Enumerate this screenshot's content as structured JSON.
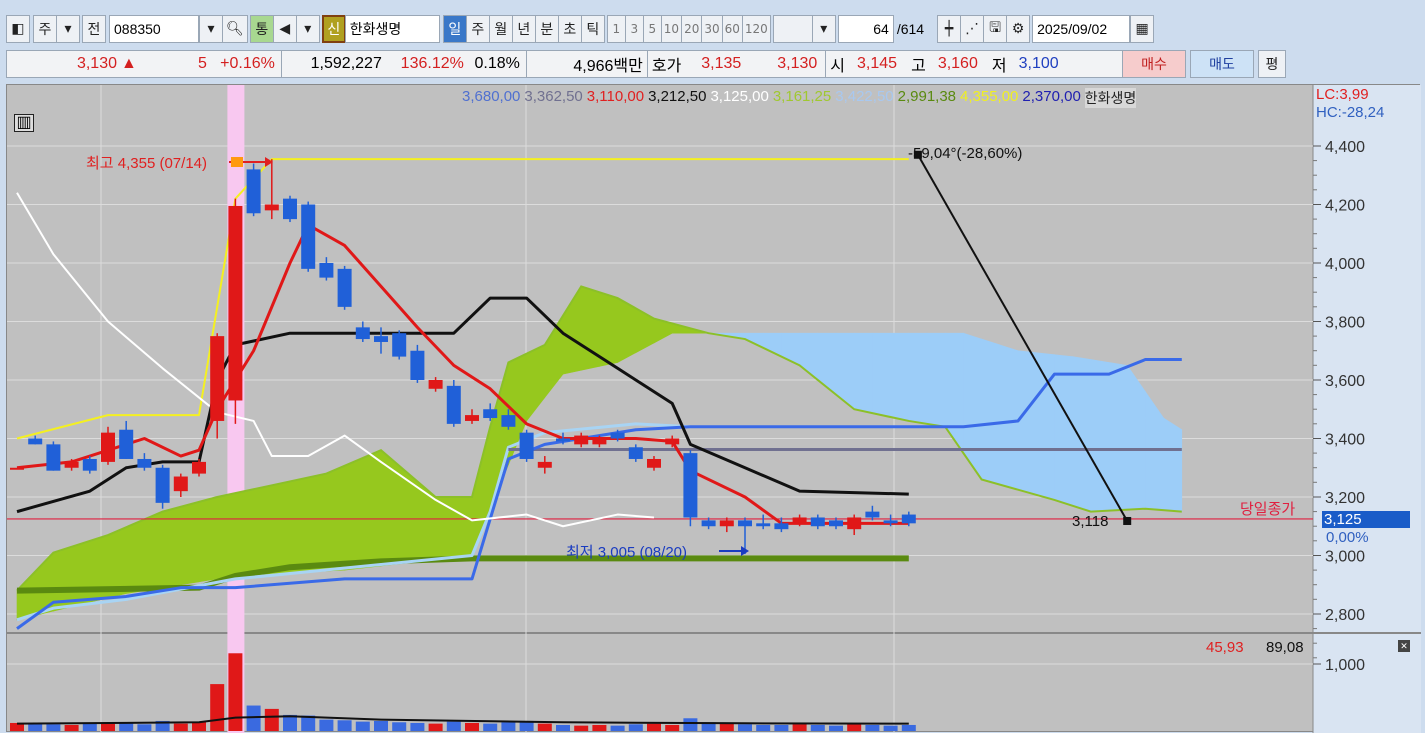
{
  "toolbar": {
    "market": "주",
    "prev": "전",
    "code": "088350",
    "tong": "통",
    "sin": "신",
    "stock_name": "한화생명",
    "periods": [
      "일",
      "주",
      "월",
      "년",
      "분",
      "초",
      "틱"
    ],
    "intervals": [
      "1",
      "3",
      "5",
      "10",
      "20",
      "30",
      "60",
      "120"
    ],
    "count": "64",
    "total": "/614",
    "date": "2025/09/02"
  },
  "info": {
    "price": "3,130",
    "arrow": "▲",
    "change": "5",
    "change_pct": "+0.16%",
    "volume": "1,592,227",
    "vol_ratio": "136.12%",
    "turnover": "0.18%",
    "amount": "4,966백만",
    "hoga_label": "호가",
    "ask": "3,135",
    "bid": "3,130",
    "open_label": "시",
    "open": "3,145",
    "high_label": "고",
    "high": "3,160",
    "low_label": "저",
    "low": "3,100",
    "buy": "매수",
    "sell": "매도",
    "avg": "평"
  },
  "legend": [
    {
      "t": "3,680,00",
      "c": "#5070d0"
    },
    {
      "t": "3,362,50",
      "c": "#707090"
    },
    {
      "t": "3,110,00",
      "c": "#e02020"
    },
    {
      "t": "3,212,50",
      "c": "#111111"
    },
    {
      "t": "3,125,00",
      "c": "#ffffff"
    },
    {
      "t": "3,161,25",
      "c": "#a0c830"
    },
    {
      "t": "3,422,50",
      "c": "#a8c8f0"
    },
    {
      "t": "2,991,38",
      "c": "#5a8a10"
    },
    {
      "t": "4,355,00",
      "c": "#f0f020"
    },
    {
      "t": "2,370,00",
      "c": "#2020b0"
    },
    {
      "t": "한화생명",
      "c": "#222222"
    }
  ],
  "lc": "LC:3,99",
  "hc": "HC:-28,24",
  "annotations": {
    "high": "최고 4,355 (07/14)",
    "low": "최저 3,005 (08/20)",
    "trend": "-59,04°(-28,60%)",
    "trend_end": "3,118",
    "close_label": "당일종가",
    "current_price": "3,125",
    "current_pct": "0,00%",
    "vol_legend1": "45,93",
    "vol_legend2": "89,08"
  },
  "colors": {
    "up": "#e01818",
    "down": "#2060d8"
  },
  "chart_data": {
    "type": "candlestick",
    "price_axis": {
      "ticks": [
        "4,400",
        "4,200",
        "4,000",
        "3,800",
        "3,600",
        "3,400",
        "3,200",
        "3,000",
        "2,800"
      ],
      "range": [
        2800,
        4400
      ]
    },
    "volume_axis": {
      "ticks": [
        "1,000"
      ]
    },
    "candles": [
      [
        3300,
        3420,
        3420,
        3300
      ],
      [
        3400,
        3410,
        3380,
        3380
      ],
      [
        3380,
        3390,
        3290,
        3290
      ],
      [
        3300,
        3330,
        3290,
        3320
      ],
      [
        3330,
        3340,
        3280,
        3290
      ],
      [
        3320,
        3440,
        3310,
        3420
      ],
      [
        3430,
        3460,
        3330,
        3330
      ],
      [
        3330,
        3350,
        3290,
        3300
      ],
      [
        3300,
        3310,
        3160,
        3180
      ],
      [
        3220,
        3280,
        3200,
        3270
      ],
      [
        3280,
        3330,
        3270,
        3320
      ],
      [
        3460,
        3760,
        3400,
        3750
      ],
      [
        3530,
        4220,
        3450,
        4195
      ],
      [
        4320,
        4340,
        4160,
        4170
      ],
      [
        4180,
        4355,
        4150,
        4200
      ],
      [
        4220,
        4230,
        4140,
        4150
      ],
      [
        4200,
        4210,
        3970,
        3980
      ],
      [
        4000,
        4020,
        3940,
        3950
      ],
      [
        3980,
        3990,
        3840,
        3850
      ],
      [
        3780,
        3800,
        3730,
        3740
      ],
      [
        3750,
        3780,
        3690,
        3730
      ],
      [
        3760,
        3770,
        3670,
        3680
      ],
      [
        3700,
        3720,
        3590,
        3600
      ],
      [
        3570,
        3610,
        3560,
        3600
      ],
      [
        3580,
        3600,
        3440,
        3450
      ],
      [
        3460,
        3500,
        3450,
        3480
      ],
      [
        3500,
        3520,
        3460,
        3470
      ],
      [
        3480,
        3500,
        3430,
        3440
      ],
      [
        3420,
        3430,
        3320,
        3330
      ],
      [
        3300,
        3340,
        3280,
        3320
      ],
      [
        3400,
        3420,
        3380,
        3390
      ],
      [
        3380,
        3420,
        3370,
        3410
      ],
      [
        3380,
        3410,
        3370,
        3400
      ],
      [
        3420,
        3430,
        3390,
        3400
      ],
      [
        3370,
        3380,
        3320,
        3330
      ],
      [
        3300,
        3340,
        3290,
        3330
      ],
      [
        3380,
        3410,
        3370,
        3400
      ],
      [
        3350,
        3360,
        3100,
        3130
      ],
      [
        3120,
        3130,
        3090,
        3100
      ],
      [
        3100,
        3130,
        3080,
        3120
      ],
      [
        3120,
        3130,
        3005,
        3100
      ],
      [
        3110,
        3140,
        3090,
        3100
      ],
      [
        3110,
        3130,
        3080,
        3090
      ],
      [
        3110,
        3140,
        3100,
        3130
      ],
      [
        3130,
        3140,
        3090,
        3100
      ],
      [
        3120,
        3130,
        3090,
        3100
      ],
      [
        3090,
        3140,
        3070,
        3130
      ],
      [
        3150,
        3170,
        3120,
        3130
      ],
      [
        3120,
        3140,
        3100,
        3110
      ],
      [
        3140,
        3150,
        3100,
        3110
      ]
    ],
    "volume": [
      120,
      110,
      100,
      90,
      110,
      130,
      120,
      100,
      150,
      110,
      140,
      700,
      1160,
      380,
      330,
      240,
      230,
      170,
      160,
      140,
      150,
      130,
      120,
      110,
      140,
      120,
      110,
      130,
      150,
      110,
      90,
      80,
      90,
      80,
      100,
      110,
      90,
      190,
      130,
      110,
      100,
      90,
      90,
      100,
      90,
      80,
      100,
      90,
      80,
      90
    ],
    "volume_ma": [
      [
        0,
        110
      ],
      [
        10,
        130
      ],
      [
        12,
        200
      ],
      [
        15,
        220
      ],
      [
        20,
        170
      ],
      [
        30,
        130
      ],
      [
        40,
        115
      ],
      [
        49,
        110
      ]
    ],
    "lines": [
      {
        "name": "max-line",
        "color": "#f4f020",
        "w": 2,
        "pts": [
          [
            0,
            3400
          ],
          [
            5,
            3480
          ],
          [
            10,
            3480
          ],
          [
            12,
            4220
          ],
          [
            14,
            4355
          ],
          [
            49,
            4355
          ]
        ]
      },
      {
        "name": "olive-line",
        "color": "#5a8a10",
        "w": 6,
        "pts": [
          [
            0,
            2880
          ],
          [
            10,
            2890
          ],
          [
            12,
            2930
          ],
          [
            15,
            2960
          ],
          [
            20,
            2980
          ],
          [
            25,
            2990
          ],
          [
            49,
            2990
          ]
        ]
      },
      {
        "name": "lightblue-line",
        "color": "#a8d4f4",
        "w": 3,
        "pts": [
          [
            0,
            2780
          ],
          [
            2,
            2820
          ],
          [
            6,
            2850
          ],
          [
            12,
            2920
          ],
          [
            25,
            3000
          ],
          [
            26,
            3150
          ],
          [
            27,
            3370
          ],
          [
            29,
            3420
          ],
          [
            34,
            3450
          ],
          [
            37,
            3440
          ]
        ]
      },
      {
        "name": "gray-hline",
        "color": "#707090",
        "w": 3,
        "pts": [
          [
            27,
            3362.5
          ],
          [
            64,
            3362.5
          ]
        ]
      },
      {
        "name": "blue-line",
        "color": "#3a6ae8",
        "w": 3,
        "pts": [
          [
            0,
            2750
          ],
          [
            2,
            2840
          ],
          [
            6,
            2860
          ],
          [
            9,
            2890
          ],
          [
            12,
            2890
          ],
          [
            18,
            2920
          ],
          [
            25,
            2920
          ],
          [
            27,
            3330
          ],
          [
            29,
            3380
          ],
          [
            34,
            3430
          ],
          [
            37,
            3440
          ],
          [
            52,
            3440
          ],
          [
            55,
            3460
          ],
          [
            57,
            3620
          ],
          [
            60,
            3620
          ],
          [
            62,
            3670
          ],
          [
            64,
            3670
          ]
        ]
      },
      {
        "name": "white-line",
        "color": "#ffffff",
        "w": 2,
        "pts": [
          [
            0,
            4240
          ],
          [
            2,
            4030
          ],
          [
            5,
            3800
          ],
          [
            8,
            3640
          ],
          [
            11,
            3490
          ],
          [
            13,
            3460
          ],
          [
            14,
            3340
          ],
          [
            16,
            3340
          ],
          [
            18,
            3410
          ],
          [
            20,
            3320
          ],
          [
            23,
            3190
          ],
          [
            25,
            3120
          ],
          [
            28,
            3140
          ],
          [
            30,
            3100
          ],
          [
            33,
            3140
          ],
          [
            35,
            3130
          ]
        ]
      },
      {
        "name": "black-line",
        "color": "#111111",
        "w": 3,
        "pts": [
          [
            0,
            3150
          ],
          [
            4,
            3220
          ],
          [
            6,
            3300
          ],
          [
            8,
            3320
          ],
          [
            10,
            3320
          ],
          [
            11,
            3600
          ],
          [
            12,
            3720
          ],
          [
            15,
            3760
          ],
          [
            24,
            3760
          ],
          [
            26,
            3880
          ],
          [
            28,
            3880
          ],
          [
            30,
            3760
          ],
          [
            33,
            3640
          ],
          [
            36,
            3520
          ],
          [
            37,
            3380
          ],
          [
            40,
            3300
          ],
          [
            43,
            3220
          ],
          [
            49,
            3210
          ]
        ]
      },
      {
        "name": "red-line",
        "color": "#e01818",
        "w": 3,
        "pts": [
          [
            0,
            3300
          ],
          [
            3,
            3320
          ],
          [
            7,
            3400
          ],
          [
            9,
            3340
          ],
          [
            10,
            3360
          ],
          [
            11,
            3500
          ],
          [
            13,
            3700
          ],
          [
            15,
            4000
          ],
          [
            16,
            4130
          ],
          [
            18,
            4060
          ],
          [
            20,
            3920
          ],
          [
            22,
            3780
          ],
          [
            24,
            3650
          ],
          [
            26,
            3570
          ],
          [
            28,
            3450
          ],
          [
            30,
            3400
          ],
          [
            34,
            3400
          ],
          [
            36,
            3390
          ],
          [
            37,
            3290
          ],
          [
            40,
            3200
          ],
          [
            42,
            3110
          ],
          [
            49,
            3110
          ]
        ]
      }
    ],
    "cloud": {
      "span_a": [
        [
          0,
          2880
        ],
        [
          2,
          3010
        ],
        [
          5,
          3070
        ],
        [
          8,
          3150
        ],
        [
          11,
          3200
        ],
        [
          14,
          3240
        ],
        [
          17,
          3280
        ],
        [
          20,
          3360
        ],
        [
          23,
          3200
        ],
        [
          25,
          3200
        ],
        [
          26,
          3440
        ],
        [
          27,
          3660
        ],
        [
          29,
          3720
        ],
        [
          31,
          3920
        ],
        [
          33,
          3880
        ],
        [
          35,
          3810
        ],
        [
          38,
          3760
        ],
        [
          40,
          3740
        ],
        [
          43,
          3650
        ],
        [
          46,
          3500
        ],
        [
          49,
          3460
        ],
        [
          51,
          3440
        ],
        [
          53,
          3260
        ],
        [
          57,
          3190
        ],
        [
          59,
          3150
        ],
        [
          62,
          3160
        ],
        [
          64,
          3150
        ]
      ],
      "span_b": [
        [
          0,
          2780
        ],
        [
          6,
          2870
        ],
        [
          12,
          2930
        ],
        [
          18,
          2950
        ],
        [
          25,
          3000
        ],
        [
          26,
          3160
        ],
        [
          28,
          3460
        ],
        [
          30,
          3620
        ],
        [
          33,
          3660
        ],
        [
          36,
          3760
        ],
        [
          52,
          3760
        ],
        [
          55,
          3700
        ],
        [
          58,
          3680
        ],
        [
          61,
          3650
        ],
        [
          63,
          3470
        ],
        [
          64,
          3430
        ]
      ]
    },
    "close_line": 3125,
    "trendline": [
      [
        49.5,
        4370
      ],
      [
        61,
        3118
      ]
    ]
  }
}
